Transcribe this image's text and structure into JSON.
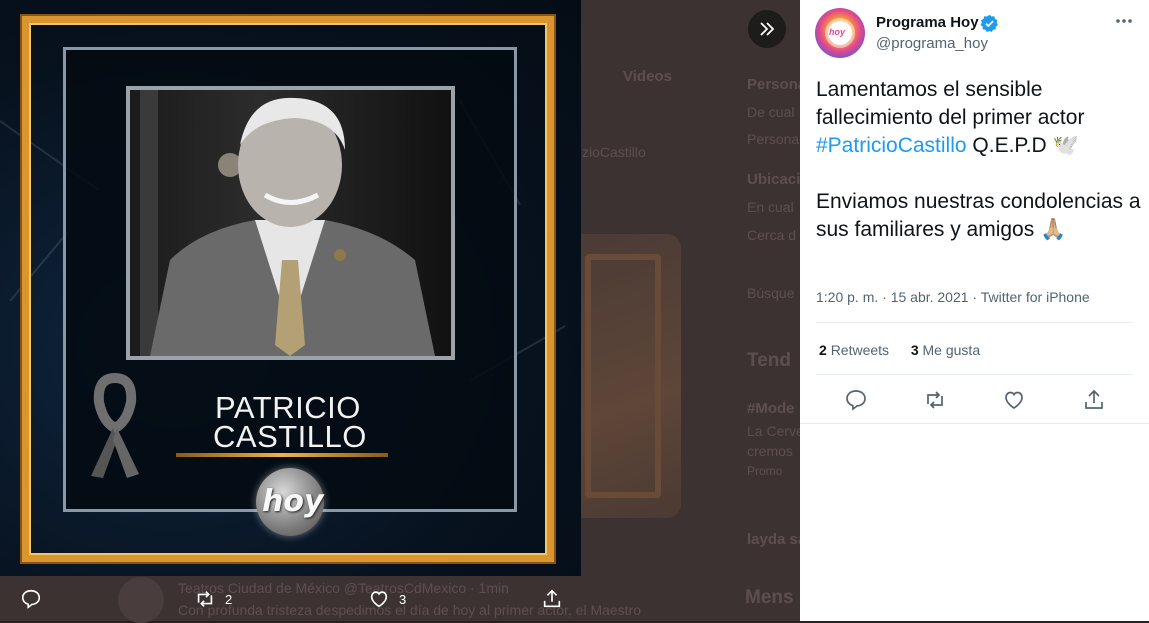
{
  "background_page": {
    "lines": [
      {
        "text": "Videos"
      },
      {
        "text": "Persona"
      },
      {
        "text": "De cual"
      },
      {
        "text": "Persona"
      },
      {
        "text": "zioCastillo"
      },
      {
        "text": "Ubicaci"
      },
      {
        "text": "En cual"
      },
      {
        "text": "Cerca d"
      },
      {
        "text": "Búsque"
      },
      {
        "text": "Tend"
      },
      {
        "text": "#Mode"
      },
      {
        "text": "La Cerve"
      },
      {
        "text": "cremos"
      },
      {
        "text": "Promo"
      },
      {
        "text": "layda sa"
      },
      {
        "text": "Mens"
      }
    ],
    "bottom_tweet_header": "Teatros Ciudad de México @TeatrosCdMexico · 1min",
    "bottom_tweet_body": "Con profunda tristeza despedimos el día de hoy al primer actor, el Maestro"
  },
  "media": {
    "name_line1": "PATRICIO",
    "name_line2": "CASTILLO",
    "logo_text": "hoy",
    "colors": {
      "frame": "#d9962e",
      "background": "#07121f"
    }
  },
  "media_actions": {
    "retweet_count": "2",
    "like_count": "3"
  },
  "tweet": {
    "display_name": "Programa Hoy",
    "handle": "@programa_hoy",
    "text_line1": "Lamentamos el sensible fallecimiento del primer actor ",
    "hashtag": "#PatricioCastillo",
    "text_line1_end": " Q.E.P.D 🕊️",
    "text_para2": "Enviamos nuestras condolencias a sus familiares y amigos 🙏🏼",
    "timestamp": "1:20 p. m. · 15 abr. 2021 · Twitter for iPhone",
    "retweets_count": "2",
    "retweets_label": "Retweets",
    "likes_count": "3",
    "likes_label": "Me gusta",
    "avatar_text": "hoy",
    "accent_color": "#1d9bf0"
  }
}
